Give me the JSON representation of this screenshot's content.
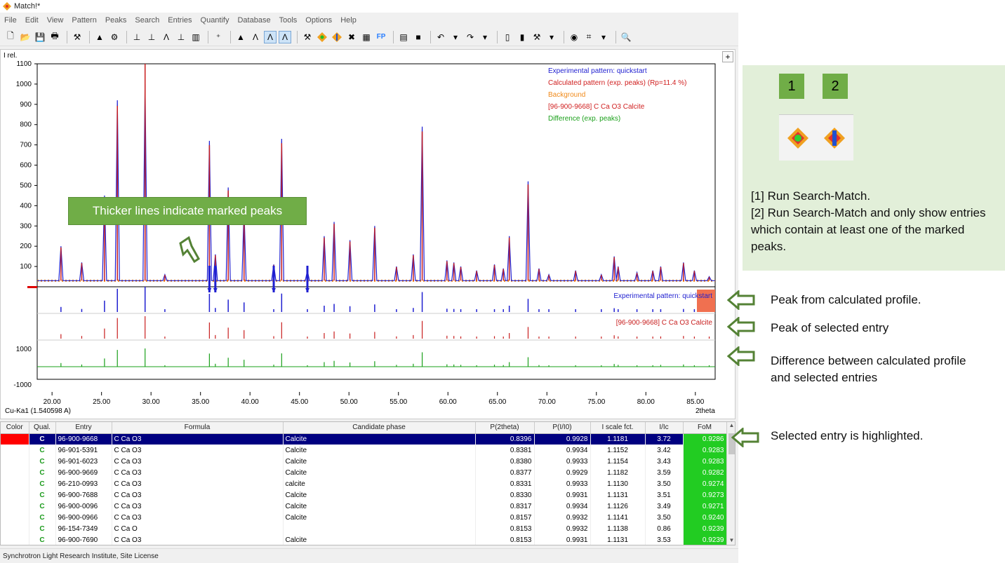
{
  "window": {
    "title": "Match!*"
  },
  "menu": [
    "File",
    "Edit",
    "View",
    "Pattern",
    "Peaks",
    "Search",
    "Entries",
    "Quantify",
    "Database",
    "Tools",
    "Options",
    "Help"
  ],
  "toolbar": {
    "fp_label": "FP"
  },
  "plot": {
    "y_label": "I rel.",
    "x_label": "2theta",
    "wavelength": "Cu-Ka1 (1.540598 A)",
    "y_ticks": [
      "1100",
      "1000",
      "900",
      "800",
      "700",
      "600",
      "500",
      "400",
      "300",
      "200",
      "100"
    ],
    "diff_ticks": [
      "1000",
      "-1000"
    ],
    "x_ticks": [
      "20.00",
      "25.00",
      "30.00",
      "35.00",
      "40.00",
      "45.00",
      "50.00",
      "55.00",
      "60.00",
      "65.00",
      "70.00",
      "75.00",
      "80.00",
      "85.00"
    ],
    "legend": [
      {
        "text": "Experimental pattern: quickstart",
        "color": "#1f1fd0"
      },
      {
        "text": "Calculated pattern (exp. peaks) (Rp=11.4 %)",
        "color": "#d01f1f"
      },
      {
        "text": "Background",
        "color": "#f08a1a"
      },
      {
        "text": "[96-900-9668] C Ca O3 Calcite",
        "color": "#d01f1f"
      },
      {
        "text": "Difference (exp. peaks)",
        "color": "#1aa01a"
      }
    ],
    "exp_bar_label": "Experimental pattern: quickstart",
    "entry_bar_label": "[96-900-9668] C Ca O3 Calcite",
    "callout": "Thicker lines indicate marked peaks",
    "colors": {
      "experimental": "#1f1fd0",
      "calculated": "#c81e1e",
      "background": "#f08a1a",
      "difference": "#1aa01a"
    }
  },
  "chart_data": {
    "type": "line",
    "xlabel": "2theta",
    "ylabel": "I rel.",
    "xlim": [
      18.5,
      87
    ],
    "ylim": [
      0,
      1100
    ],
    "peaks": [
      {
        "x": 20.9,
        "y": 200
      },
      {
        "x": 23.0,
        "y": 120
      },
      {
        "x": 25.3,
        "y": 450
      },
      {
        "x": 26.6,
        "y": 920
      },
      {
        "x": 29.4,
        "y": 1000
      },
      {
        "x": 31.4,
        "y": 60
      },
      {
        "x": 35.9,
        "y": 720
      },
      {
        "x": 36.5,
        "y": 160
      },
      {
        "x": 37.8,
        "y": 490
      },
      {
        "x": 39.4,
        "y": 380
      },
      {
        "x": 42.4,
        "y": 110
      },
      {
        "x": 43.2,
        "y": 730
      },
      {
        "x": 45.8,
        "y": 80
      },
      {
        "x": 47.5,
        "y": 250
      },
      {
        "x": 48.5,
        "y": 320
      },
      {
        "x": 50.1,
        "y": 230
      },
      {
        "x": 52.6,
        "y": 300
      },
      {
        "x": 54.8,
        "y": 100
      },
      {
        "x": 56.5,
        "y": 160
      },
      {
        "x": 57.4,
        "y": 790
      },
      {
        "x": 59.9,
        "y": 130
      },
      {
        "x": 60.6,
        "y": 120
      },
      {
        "x": 61.3,
        "y": 100
      },
      {
        "x": 62.9,
        "y": 80
      },
      {
        "x": 64.7,
        "y": 110
      },
      {
        "x": 65.6,
        "y": 90
      },
      {
        "x": 66.2,
        "y": 250
      },
      {
        "x": 68.1,
        "y": 520
      },
      {
        "x": 69.2,
        "y": 90
      },
      {
        "x": 70.2,
        "y": 60
      },
      {
        "x": 72.9,
        "y": 80
      },
      {
        "x": 75.5,
        "y": 60
      },
      {
        "x": 76.8,
        "y": 150
      },
      {
        "x": 77.2,
        "y": 100
      },
      {
        "x": 79.1,
        "y": 70
      },
      {
        "x": 80.7,
        "y": 80
      },
      {
        "x": 81.5,
        "y": 100
      },
      {
        "x": 83.8,
        "y": 120
      },
      {
        "x": 84.9,
        "y": 80
      },
      {
        "x": 86.4,
        "y": 50
      }
    ],
    "background_level": 30
  },
  "table": {
    "headers": [
      "Color",
      "Qual.",
      "Entry",
      "Formula",
      "Candidate phase",
      "P(2theta)",
      "P(I/I0)",
      "I scale fct.",
      "I/Ic",
      "FoM"
    ],
    "rows": [
      [
        "",
        "C",
        "96-900-9668",
        "C Ca O3",
        "Calcite",
        "0.8396",
        "0.9928",
        "1.1181",
        "3.72",
        "0.9286"
      ],
      [
        "",
        "C",
        "96-901-5391",
        "C Ca O3",
        "Calcite",
        "0.8381",
        "0.9934",
        "1.1152",
        "3.42",
        "0.9283"
      ],
      [
        "",
        "C",
        "96-901-6023",
        "C Ca O3",
        "Calcite",
        "0.8380",
        "0.9933",
        "1.1154",
        "3.43",
        "0.9283"
      ],
      [
        "",
        "C",
        "96-900-9669",
        "C Ca O3",
        "Calcite",
        "0.8377",
        "0.9929",
        "1.1182",
        "3.59",
        "0.9282"
      ],
      [
        "",
        "C",
        "96-210-0993",
        "C Ca O3",
        "calcite",
        "0.8331",
        "0.9933",
        "1.1130",
        "3.50",
        "0.9274"
      ],
      [
        "",
        "C",
        "96-900-7688",
        "C Ca O3",
        "Calcite",
        "0.8330",
        "0.9931",
        "1.1131",
        "3.51",
        "0.9273"
      ],
      [
        "",
        "C",
        "96-900-0096",
        "C Ca O3",
        "Calcite",
        "0.8317",
        "0.9934",
        "1.1126",
        "3.49",
        "0.9271"
      ],
      [
        "",
        "C",
        "96-900-0966",
        "C Ca O3",
        "Calcite",
        "0.8157",
        "0.9932",
        "1.1141",
        "3.50",
        "0.9240"
      ],
      [
        "",
        "C",
        "96-154-7349",
        "C Ca O",
        "",
        "0.8153",
        "0.9932",
        "1.1138",
        "0.86",
        "0.9239"
      ],
      [
        "",
        "C",
        "96-900-7690",
        "C Ca O3",
        "Calcite",
        "0.8153",
        "0.9931",
        "1.1131",
        "3.53",
        "0.9239"
      ]
    ]
  },
  "status": "Synchrotron Light Research Institute, Site License",
  "annotations": {
    "badge_1": "1",
    "badge_2": "2",
    "info_line1": "[1] Run Search-Match.",
    "info_line2": "[2] Run Search-Match and only show entries which contain at least one of the marked peaks.",
    "peak_calc": "Peak from calculated profile.",
    "peak_entry": "Peak of selected entry",
    "difference": "Difference between calculated profile and selected entries",
    "selected": "Selected entry is highlighted."
  }
}
